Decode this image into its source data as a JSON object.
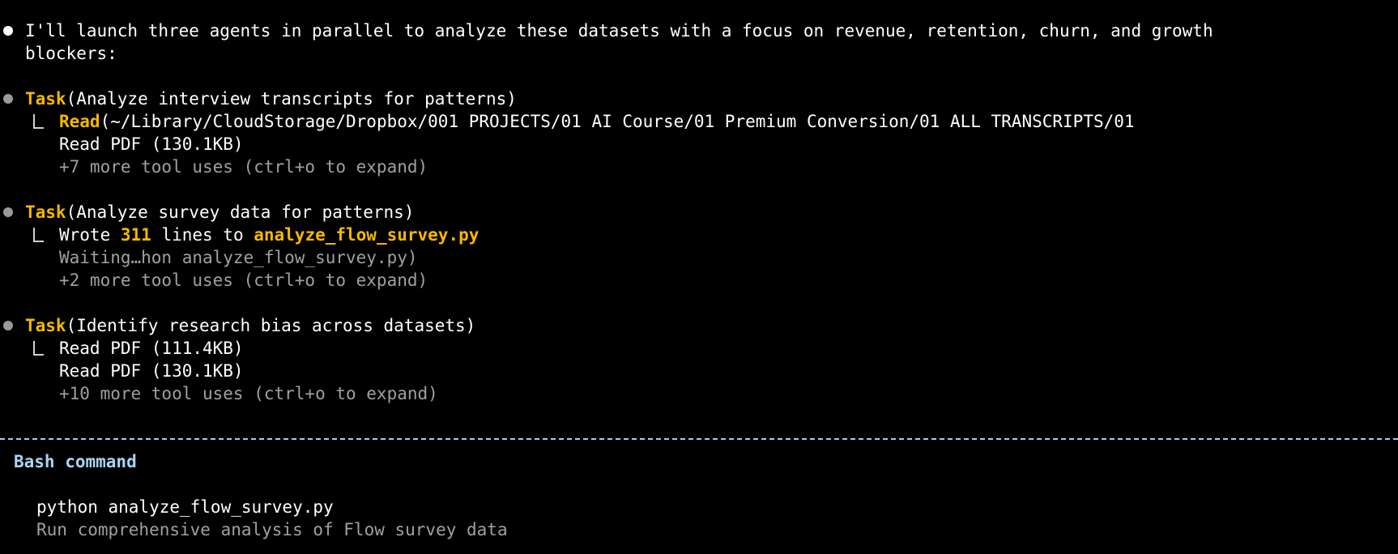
{
  "intro": {
    "line1": "I'll launch three agents in parallel to analyze these datasets with a focus on revenue, retention, churn, and growth",
    "line2": "blockers:"
  },
  "tasks": [
    {
      "label": "Task",
      "title": "(Analyze interview transcripts for patterns)",
      "sub_tool": "Read",
      "sub_rest": "(~/Library/CloudStorage/Dropbox/001 PROJECTS/01 AI Course/01 Premium Conversion/01 ALL TRANSCRIPTS/01",
      "line2": "Read PDF (130.1KB)",
      "more": "+7 more tool uses (ctrl+o to expand)"
    },
    {
      "label": "Task",
      "title": "(Analyze survey data for patterns)",
      "sub_prefix": "Wrote ",
      "sub_count": "311",
      "sub_mid": " lines to ",
      "sub_file": "analyze_flow_survey.py",
      "line2": "Waiting…hon analyze_flow_survey.py)",
      "more": "+2 more tool uses (ctrl+o to expand)"
    },
    {
      "label": "Task",
      "title": "(Identify research bias across datasets)",
      "sub_text": "Read PDF (111.4KB)",
      "line2": "Read PDF (130.1KB)",
      "more": "+10 more tool uses (ctrl+o to expand)"
    }
  ],
  "bash": {
    "title": "Bash command",
    "command": "python analyze_flow_survey.py",
    "description": "Run comprehensive analysis of Flow survey data"
  },
  "colors": {
    "background": "#000000",
    "accent_yellow": "#f5b800",
    "dim_text": "#a0a0a0",
    "bash_title": "#a9d4f5",
    "divider": "#a9cde8"
  }
}
